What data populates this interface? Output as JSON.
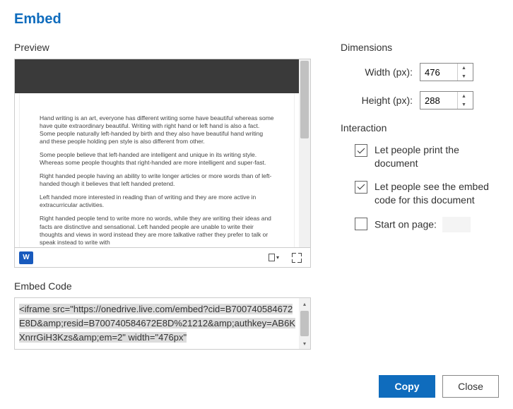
{
  "title": "Embed",
  "preview": {
    "label": "Preview",
    "document": {
      "p1": "Hand writing is an art, everyone has different writing some have beautiful whereas some have quite extraordinary beautiful. Writing with right hand or left hand is also a fact. Some people naturally left-handed by birth and they also have beautiful hand writing and these people holding pen style is also different from other.",
      "p2": "Some people believe that left-handed are intelligent and unique in its writing style. Whereas some people thoughts that right-handed are more intelligent and super-fast.",
      "p3": "Right handed people having an ability to write longer articles or more words than of left-handed though it believes that left handed pretend.",
      "p4": "Left handed more interested in reading than of writing and they are more active in extracurricular activities.",
      "p5": "Right handed people tend to write more no words, while they are writing their ideas and facts are distinctive and sensational. Left handed people are unable to write their thoughts and views in word instead they are more talkative rather they prefer to talk or speak instead to write with"
    },
    "word_badge": "W"
  },
  "embed_code": {
    "label": "Embed Code",
    "value": "<iframe src=\"https://onedrive.live.com/embed?cid=B700740584672E8D&amp;resid=B700740584672E8D%21212&amp;authkey=AB6KXnrrGiH3Kzs&amp;em=2\" width=\"476px\""
  },
  "dimensions": {
    "label": "Dimensions",
    "width_label": "Width (px):",
    "width_value": "476",
    "height_label": "Height (px):",
    "height_value": "288"
  },
  "interaction": {
    "label": "Interaction",
    "print_label": "Let people print the document",
    "embed_code_label": "Let people see the embed code for this document",
    "start_page_label": "Start on page:",
    "start_page_value": ""
  },
  "buttons": {
    "copy": "Copy",
    "close": "Close"
  }
}
